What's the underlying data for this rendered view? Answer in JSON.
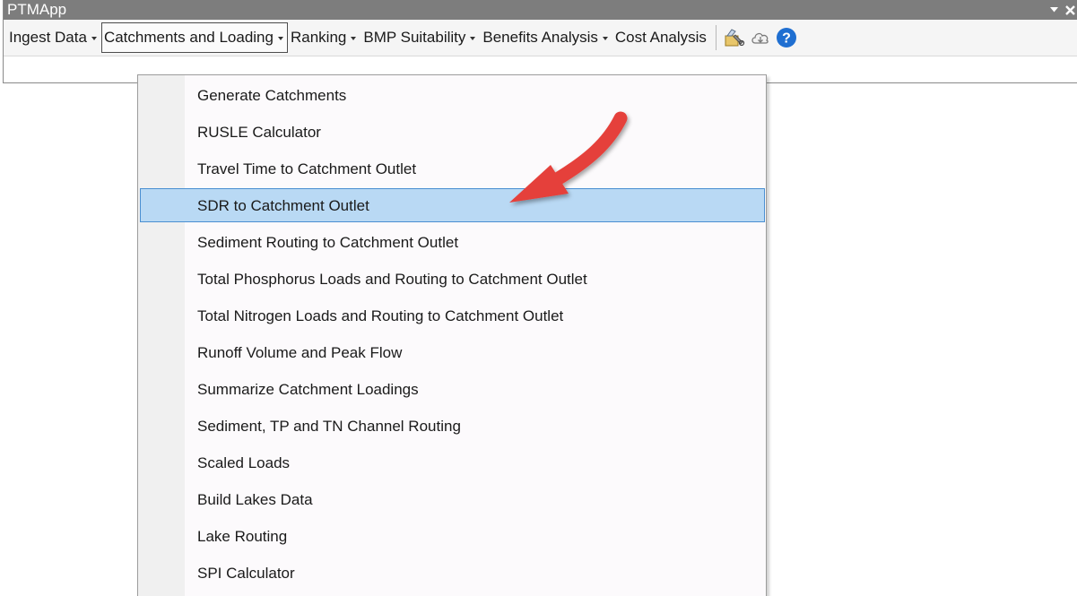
{
  "window": {
    "title": "PTMApp",
    "dropdown_icon": "chevron-down-icon",
    "close_icon": "close-icon"
  },
  "toolbar": {
    "items": [
      {
        "label": "Ingest Data",
        "has_dropdown": true
      },
      {
        "label": "Catchments and Loading",
        "has_dropdown": true,
        "active": true
      },
      {
        "label": "Ranking",
        "has_dropdown": true
      },
      {
        "label": "BMP Suitability",
        "has_dropdown": true
      },
      {
        "label": "Benefits Analysis",
        "has_dropdown": true
      },
      {
        "label": "Cost Analysis",
        "has_dropdown": false
      }
    ],
    "icons": [
      "tools-icon",
      "cloud-icon",
      "help-icon"
    ]
  },
  "menu": {
    "items": [
      {
        "label": "Generate Catchments"
      },
      {
        "label": "RUSLE Calculator"
      },
      {
        "label": "Travel Time to Catchment Outlet"
      },
      {
        "label": "SDR to Catchment Outlet",
        "highlighted": true
      },
      {
        "label": "Sediment Routing to Catchment Outlet"
      },
      {
        "label": "Total Phosphorus Loads and Routing to Catchment Outlet"
      },
      {
        "label": "Total Nitrogen Loads and Routing to Catchment Outlet"
      },
      {
        "label": "Runoff Volume and Peak Flow"
      },
      {
        "label": "Summarize Catchment Loadings"
      },
      {
        "label": "Sediment, TP and TN Channel Routing"
      },
      {
        "label": "Scaled Loads"
      },
      {
        "label": "Build Lakes Data"
      },
      {
        "label": "Lake Routing"
      },
      {
        "label": "SPI Calculator"
      }
    ]
  },
  "annotation": {
    "type": "red-arrow-icon",
    "color": "#e5413a"
  },
  "colors": {
    "titlebar": "#7d7d7d",
    "highlight_fill": "#b9d9f4",
    "highlight_border": "#4a8fd1",
    "help_blue": "#1f6fd1"
  }
}
